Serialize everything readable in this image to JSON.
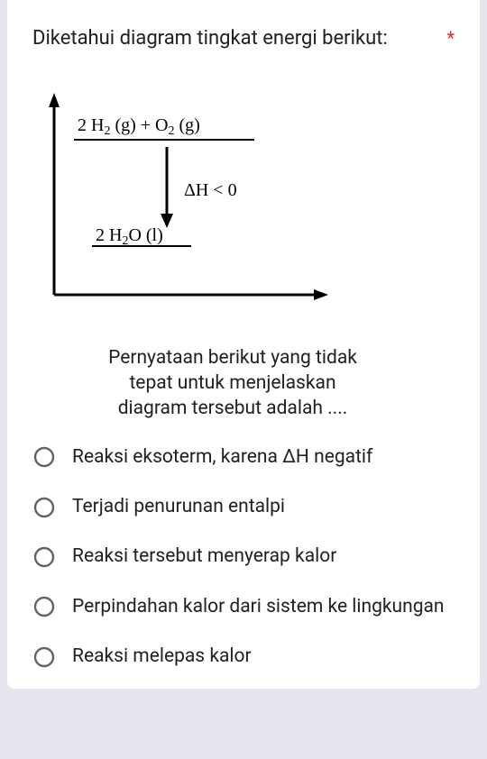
{
  "question": {
    "title": "Diketahui diagram tingkat energi berikut:",
    "required_mark": "*",
    "diagram_labels": {
      "reactants": "2 H₂ (g)  +  O₂ (g)",
      "dh": "ΔH < 0",
      "products": "2 H₂O (l)"
    },
    "prompt2_line1": "Pernyataan berikut yang tidak",
    "prompt2_line2": "tepat untuk menjelaskan",
    "prompt2_line3": "diagram tersebut adalah ....",
    "options": [
      {
        "label": "Reaksi eksoterm, karena  ΔH negatif"
      },
      {
        "label": "Terjadi penurunan entalpi"
      },
      {
        "label": "Reaksi tersebut menyerap kalor"
      },
      {
        "label": "Perpindahan kalor dari sistem ke lingkungan"
      },
      {
        "label": "Reaksi melepas kalor"
      }
    ]
  },
  "chart_data": {
    "type": "diagram",
    "description": "Energy level diagram with reactants higher than products, downward arrow, ΔH < 0",
    "levels": {
      "reactants": {
        "label": "2 H₂ (g) + O₂ (g)",
        "relative_energy": "high"
      },
      "products": {
        "label": "2 H₂O (l)",
        "relative_energy": "low"
      }
    },
    "annotation": "ΔH < 0"
  }
}
